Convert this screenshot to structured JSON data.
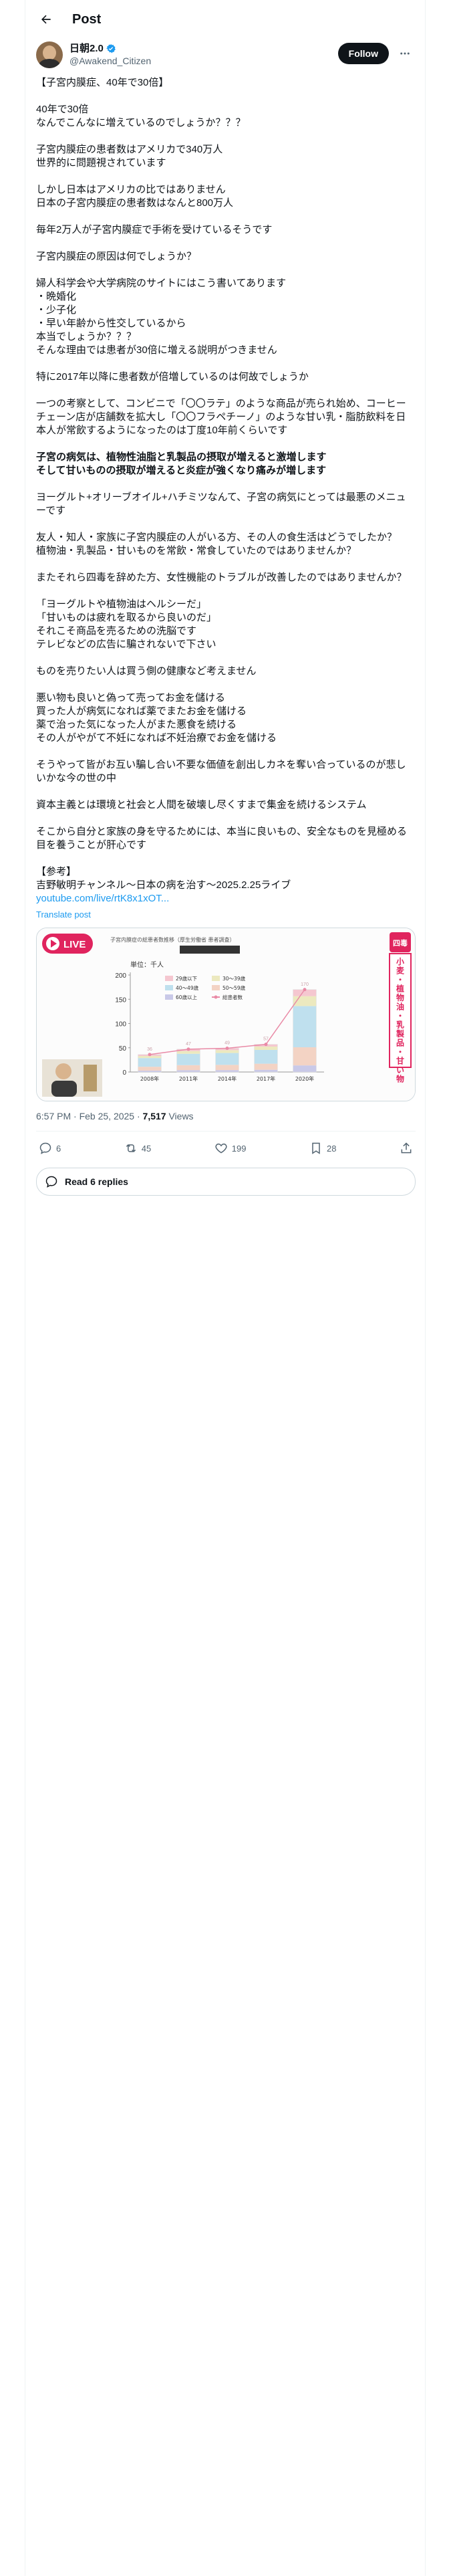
{
  "header": {
    "title": "Post"
  },
  "author": {
    "name": "日朝2.0",
    "handle": "@Awakend_Citizen",
    "follow_label": "Follow"
  },
  "tweet": {
    "paragraphs": [
      [
        "【子宮内膜症、40年で30倍】"
      ],
      [
        "40年で30倍",
        "なんでこんなに増えているのでしょうか？？？"
      ],
      [
        "子宮内膜症の患者数はアメリカで340万人",
        "世界的に問題視されています"
      ],
      [
        "しかし日本はアメリカの比ではありません",
        "日本の子宮内膜症の患者数はなんと800万人"
      ],
      [
        "毎年2万人が子宮内膜症で手術を受けているそうです"
      ],
      [
        "子宮内膜症の原因は何でしょうか？"
      ],
      [
        "婦人科学会や大学病院のサイトにはこう書いてあります",
        "・晩婚化",
        "・少子化",
        "・早い年齢から性交しているから",
        "本当でしょうか？？？",
        "そんな理由では患者が30倍に増える説明がつきません"
      ],
      [
        "特に2017年以降に患者数が倍増しているのは何故でしょうか"
      ],
      [
        "一つの考察として、コンビニで「〇〇ラテ」のような商品が売られ始め、コーヒーチェーン店が店舗数を拡大し「〇〇フラペチーノ」のような甘い乳・脂肪飲料を日本人が常飲するようになったのは丁度10年前くらいです"
      ],
      [
        "子宮の病気は、植物性油脂と乳製品の摂取が増えると激増します",
        "そして甘いものの摂取が増えると炎症が強くなり痛みが増します"
      ],
      [
        "ヨーグルト+オリーブオイル+ハチミツなんて、子宮の病気にとっては最悪のメニューです"
      ],
      [
        "友人・知人・家族に子宮内膜症の人がいる方、その人の食生活はどうでしたか？",
        "植物油・乳製品・甘いものを常飲・常食していたのではありませんか？"
      ],
      [
        "またそれら四毒を辞めた方、女性機能のトラブルが改善したのではありませんか？"
      ],
      [
        "「ヨーグルトや植物油はヘルシーだ」",
        "「甘いものは疲れを取るから良いのだ」",
        "それこそ商品を売るための洗脳です",
        "テレビなどの広告に騙されないで下さい"
      ],
      [
        "ものを売りたい人は買う側の健康など考えません"
      ],
      [
        "悪い物も良いと偽って売ってお金を儲ける",
        "買った人が病気になれば薬でまたお金を儲ける",
        "薬で治った気になった人がまた悪食を続ける",
        "その人がやがて不妊になれば不妊治療でお金を儲ける"
      ],
      [
        "そうやって皆がお互い騙し合い不要な価値を創出しカネを奪い合っているのが悲しいかな今の世の中"
      ],
      [
        "資本主義とは環境と社会と人間を破壊し尽くすまで集金を続けるシステム"
      ],
      [
        "そこから自分と家族の身を守るためには、本当に良いもの、安全なものを見極める目を養うことが肝心です"
      ],
      [
        "【参考】",
        "吉野敏明チャンネル〜日本の病を治す〜2025.2.25ライブ"
      ]
    ],
    "link": "youtube.com/live/rtK8x1xOT...",
    "translate": "Translate post",
    "timestamp": "6:57 PM · Feb 25, 2025 · ",
    "views_count": "7,517",
    "views_label": " Views"
  },
  "media": {
    "live_label": "LIVE",
    "chart_title": "子宮内膜症の総患者数推移（厚生労働省 患者調査）",
    "side_badge": "四毒",
    "side_text": "小麦・植物油・乳製品・甘い物"
  },
  "chart_data": {
    "type": "bar",
    "unit_label": "単位：千人",
    "categories": [
      "2008年",
      "2011年",
      "2014年",
      "2017年",
      "2020年"
    ],
    "values": [
      36,
      47,
      49,
      57,
      170
    ],
    "series": [
      {
        "name": "29歳以下"
      },
      {
        "name": "30〜39歳"
      },
      {
        "name": "40〜49歳"
      },
      {
        "name": "50〜59歳"
      },
      {
        "name": "60歳以上"
      },
      {
        "name": "総患者数"
      }
    ],
    "ylim": [
      0,
      200
    ],
    "yticks": [
      0,
      50,
      100,
      150,
      200
    ]
  },
  "actions": {
    "replies": "6",
    "reposts": "45",
    "likes": "199",
    "bookmarks": "28"
  },
  "read_replies": "Read 6 replies",
  "colors": {
    "accent": "#1d9bf0",
    "live_red": "#e0245e",
    "total_line": "#e98aa6"
  }
}
